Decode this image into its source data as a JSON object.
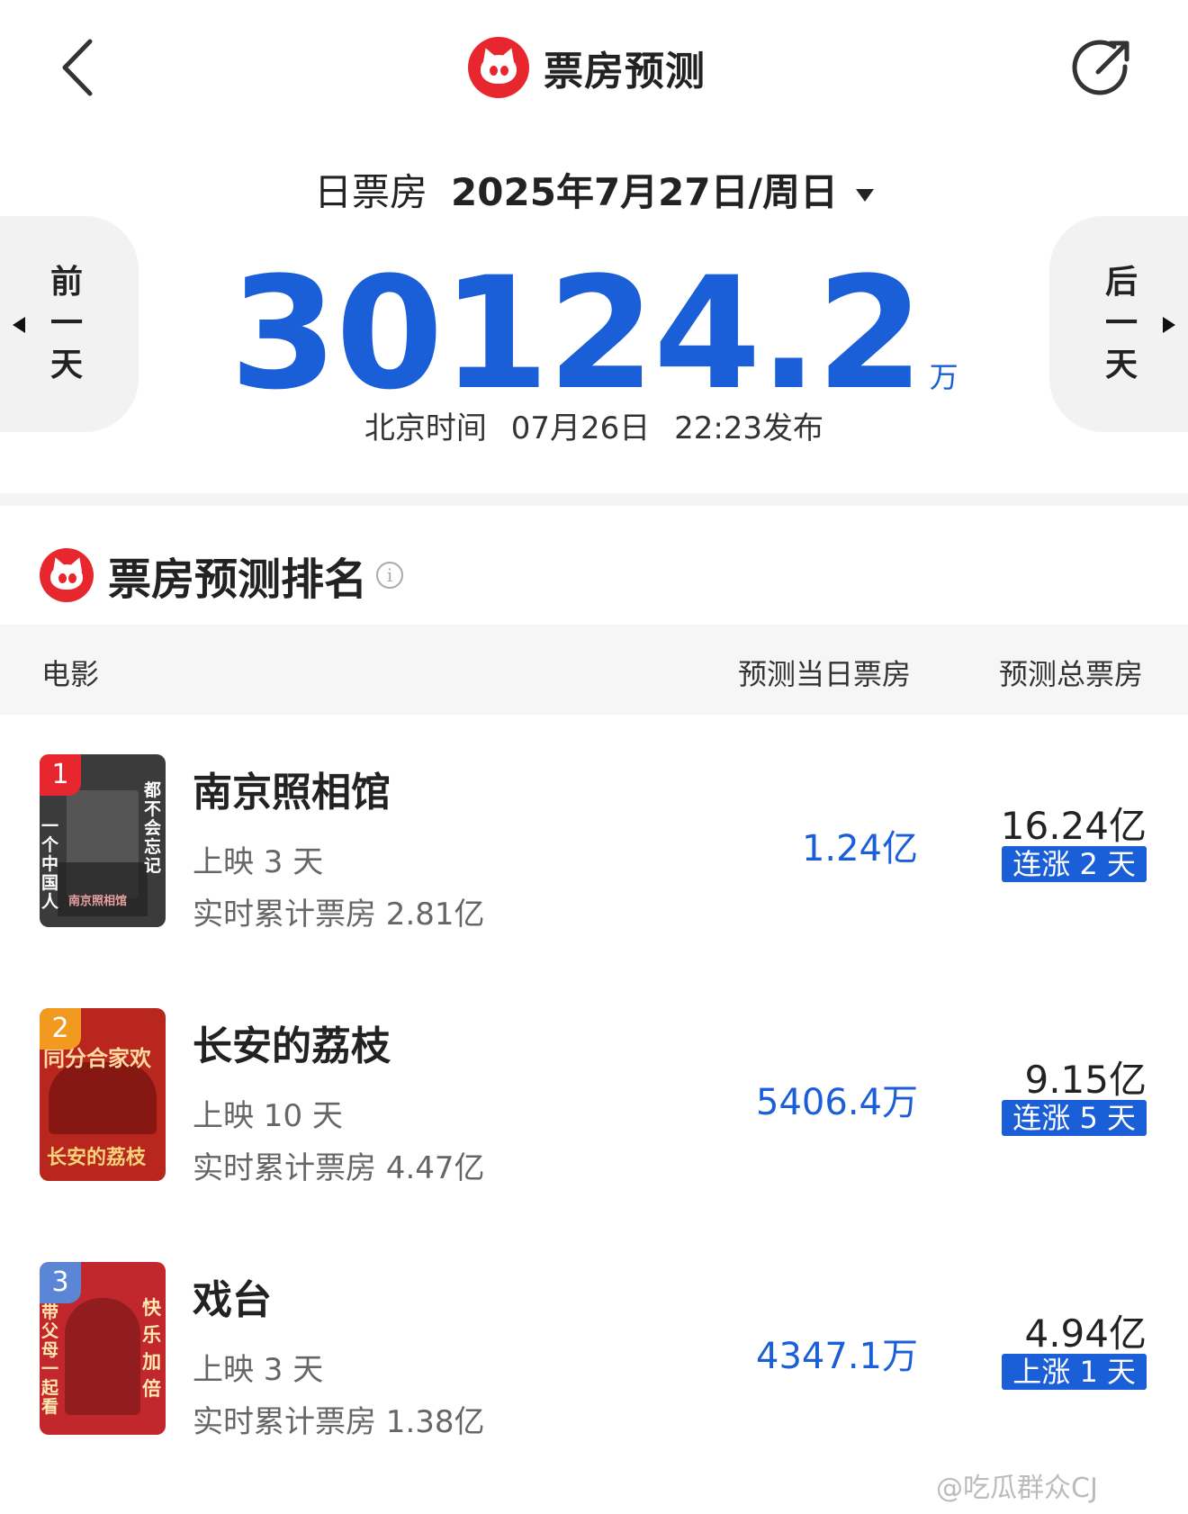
{
  "header": {
    "title": "票房预测"
  },
  "date_selector": {
    "label": "日票房",
    "date": "2025年7月27日/周日"
  },
  "nav": {
    "prev_chars": [
      "前",
      "一",
      "天"
    ],
    "next_chars": [
      "后",
      "一",
      "天"
    ]
  },
  "total": {
    "value": "30124.2",
    "unit": "万",
    "publish_prefix": "北京时间",
    "publish_date": "07月26日",
    "publish_time": "22:23发布"
  },
  "ranking": {
    "title": "票房预测排名",
    "info": "i",
    "columns": {
      "movie": "电影",
      "daily": "预测当日票房",
      "total": "预测总票房"
    },
    "movies": [
      {
        "rank": "1",
        "title": "南京照相馆",
        "days": "上映 3 天",
        "cumulative": "实时累计票房 2.81亿",
        "daily": "1.24亿",
        "total": "16.24亿",
        "trend": "连涨 2 天",
        "badge_color": "#e8262d",
        "poster_color": "#3b3b3b"
      },
      {
        "rank": "2",
        "title": "长安的荔枝",
        "days": "上映 10 天",
        "cumulative": "实时累计票房 4.47亿",
        "daily": "5406.4万",
        "total": "9.15亿",
        "trend": "连涨 5 天",
        "badge_color": "#f29a1f",
        "poster_color": "#b8261d"
      },
      {
        "rank": "3",
        "title": "戏台",
        "days": "上映 3 天",
        "cumulative": "实时累计票房 1.38亿",
        "daily": "4347.1万",
        "total": "4.94亿",
        "trend": "上涨 1 天",
        "badge_color": "#5b86d6",
        "poster_color": "#c1272d"
      }
    ]
  },
  "posters": {
    "p1_side_left": "一个中国人",
    "p1_side_right": "都不会忘记",
    "p1_center": "南京照相馆",
    "p2_top": "同分合家欢",
    "p2_bottom": "长安的荔枝",
    "p3_side_left": "带父母一起看",
    "p3_side_right": "快乐加倍"
  },
  "watermark": "@吃瓜群众CJ",
  "colors": {
    "accent_blue": "#1a5fd8",
    "brand_red": "#e8262d"
  }
}
